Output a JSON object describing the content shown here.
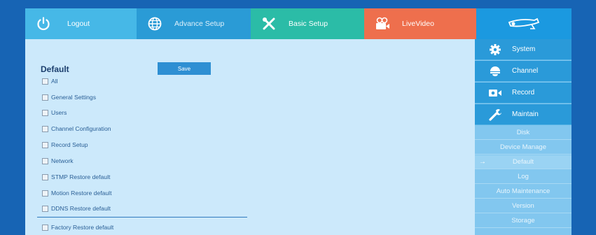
{
  "topnav": {
    "logout": "Logout",
    "advance": "Advance Setup",
    "basic": "Basic Setup",
    "live": "LiveVideo"
  },
  "page": {
    "title": "Default",
    "save_label": "Save"
  },
  "options": [
    {
      "label": "All",
      "checked": false
    },
    {
      "label": "General Settings",
      "checked": false
    },
    {
      "label": "Users",
      "checked": false
    },
    {
      "label": "Channel Configuration",
      "checked": false
    },
    {
      "label": "Record Setup",
      "checked": false
    },
    {
      "label": "Network",
      "checked": false
    },
    {
      "label": "STMP Restore default",
      "checked": false
    },
    {
      "label": "Motion Restore default",
      "checked": false
    },
    {
      "label": "DDNS Restore default",
      "checked": false
    },
    {
      "label": "Factory Restore default",
      "checked": false
    }
  ],
  "sidebar": {
    "sections": [
      {
        "label": "System",
        "icon": "gear-icon"
      },
      {
        "label": "Channel",
        "icon": "dome-camera-icon"
      },
      {
        "label": "Record",
        "icon": "video-camera-icon"
      },
      {
        "label": "Maintain",
        "icon": "wrench-icon"
      }
    ],
    "submenu": [
      {
        "label": "Disk",
        "active": false
      },
      {
        "label": "Device Manage",
        "active": false
      },
      {
        "label": "Default",
        "active": true
      },
      {
        "label": "Log",
        "active": false
      },
      {
        "label": "Auto Maintenance",
        "active": false
      },
      {
        "label": "Version",
        "active": false
      },
      {
        "label": "Storage",
        "active": false
      }
    ],
    "active_marker": "→"
  }
}
